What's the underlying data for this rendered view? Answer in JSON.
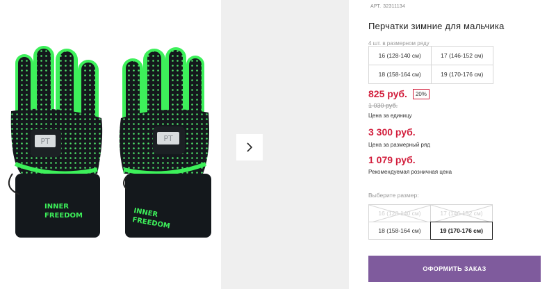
{
  "product": {
    "sku_label": "АРТ.",
    "sku": "32311134",
    "title": "Перчатки зимние для мальчика",
    "pack_note": "4 шт. в размерном ряду",
    "pack_sizes": [
      [
        "16 (128-140 см)",
        "17 (146-152 см)"
      ],
      [
        "18 (158-164 см)",
        "19 (170-176 см)"
      ]
    ]
  },
  "pricing": {
    "unit_price": "825 руб.",
    "discount": "20%",
    "old_price": "1 030 руб.",
    "unit_price_note": "Цена за единицу",
    "row_price": "3 300 руб.",
    "row_price_note": "Цена за размерный ряд",
    "rrp": "1 079 руб.",
    "rrp_note": "Рекомендуемая розничная цена"
  },
  "size_select": {
    "label": "Выберите размер:",
    "options": [
      {
        "label": "16 (128-140 см)",
        "state": "disabled"
      },
      {
        "label": "17 (146-152 см)",
        "state": "disabled"
      },
      {
        "label": "18 (158-164 см)",
        "state": "available"
      },
      {
        "label": "19 (170-176 см)",
        "state": "selected"
      }
    ]
  },
  "gloves": {
    "print_line1": "INNER",
    "print_line2": "FREEDOM",
    "tag_text": "PT"
  },
  "colors": {
    "accent_red": "#d21e3c",
    "button": "#7f5b9d",
    "glove_green": "#3df05a",
    "glove_black": "#14181c"
  },
  "actions": {
    "order_label": "ОФОРМИТЬ ЗАКАЗ"
  },
  "icons": {
    "next": "chevron-right-icon"
  }
}
